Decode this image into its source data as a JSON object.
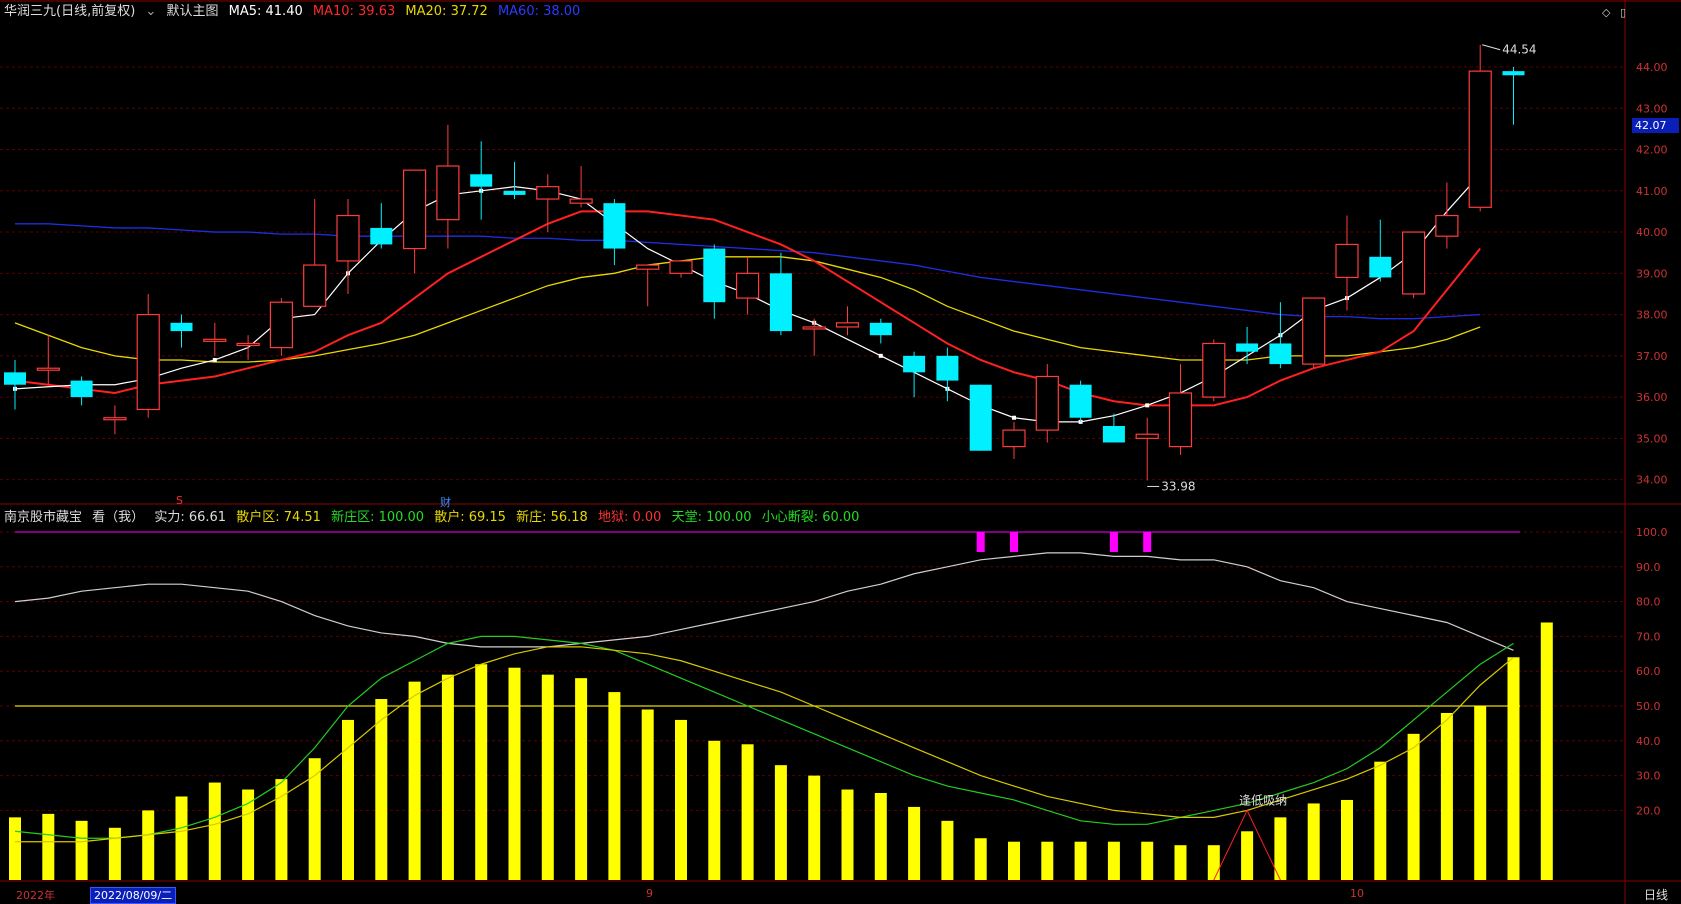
{
  "main_header": {
    "title": "华润三九(日线,前复权)",
    "dropdown_label": "默认主图",
    "ma5": "MA5: 41.40",
    "ma10": "MA10: 39.63",
    "ma20": "MA20: 37.72",
    "ma60": "MA60: 38.00"
  },
  "indicator_header": {
    "name": "南京股市藏宝",
    "view": "看（我）",
    "shili": "实力: 66.61",
    "sanhuqu": "散户区: 74.51",
    "xinzhuangqu": "新庄区: 100.00",
    "sanhu": "散户: 69.15",
    "xinzhuang": "新庄: 56.18",
    "diyu": "地狱: 0.00",
    "tiantang": "天堂: 100.00",
    "xiaoxin": "小心断裂: 60.00"
  },
  "colors": {
    "up": "#ff3c3c",
    "down": "#00f0ff",
    "ma5": "#ffffff",
    "ma10": "#ff2020",
    "ma20": "#e8d800",
    "ma60": "#1e2ee0",
    "bars": "#ffff00",
    "magenta": "#ff00ff"
  },
  "price_axis": [
    "44.00",
    "43.00",
    "42.00",
    "41.00",
    "40.00",
    "39.00",
    "38.00",
    "37.00",
    "36.00",
    "35.00",
    "34.00"
  ],
  "ind_axis": [
    "100.0",
    "90.0",
    "80.0",
    "70.0",
    "60.0",
    "50.0",
    "40.0",
    "30.0",
    "20.0"
  ],
  "current_price": "42.07",
  "high_label": "44.54",
  "low_label": "33.98",
  "event_markers": {
    "s_marker": "S",
    "cai_marker": "财"
  },
  "annotation_text": "逢低吸纳",
  "x_axis": {
    "year": "2022年",
    "date_box": "2022/08/09/二",
    "month9": "9",
    "month10": "10"
  },
  "period": "日线",
  "icons": [
    "diamond-icon",
    "settings-icon"
  ],
  "chart_data": {
    "type": "candlestick",
    "candles": [
      {
        "o": 36.6,
        "h": 36.9,
        "c": 36.3,
        "l": 35.7
      },
      {
        "o": 36.7,
        "h": 37.5,
        "c": 36.7,
        "l": 36.3
      },
      {
        "o": 36.4,
        "h": 36.5,
        "c": 36.0,
        "l": 35.8
      },
      {
        "o": 35.5,
        "h": 35.8,
        "c": 35.5,
        "l": 35.1
      },
      {
        "o": 35.7,
        "h": 38.5,
        "c": 38.0,
        "l": 35.5
      },
      {
        "o": 37.8,
        "h": 38.0,
        "c": 37.6,
        "l": 37.2
      },
      {
        "o": 37.4,
        "h": 37.8,
        "c": 37.4,
        "l": 37.0
      },
      {
        "o": 37.3,
        "h": 37.5,
        "c": 37.3,
        "l": 36.9
      },
      {
        "o": 37.2,
        "h": 38.4,
        "c": 38.3,
        "l": 37.0
      },
      {
        "o": 38.2,
        "h": 40.8,
        "c": 39.2,
        "l": 38.2
      },
      {
        "o": 39.3,
        "h": 40.8,
        "c": 40.4,
        "l": 38.5
      },
      {
        "o": 40.1,
        "h": 40.7,
        "c": 39.7,
        "l": 39.6
      },
      {
        "o": 39.6,
        "h": 41.5,
        "c": 41.5,
        "l": 39.0
      },
      {
        "o": 40.3,
        "h": 42.6,
        "c": 41.6,
        "l": 39.6
      },
      {
        "o": 41.4,
        "h": 42.2,
        "c": 41.1,
        "l": 40.3
      },
      {
        "o": 41.0,
        "h": 41.7,
        "c": 40.9,
        "l": 40.8
      },
      {
        "o": 40.8,
        "h": 41.4,
        "c": 41.1,
        "l": 40.0
      },
      {
        "o": 40.7,
        "h": 41.6,
        "c": 40.8,
        "l": 40.6
      },
      {
        "o": 40.7,
        "h": 40.8,
        "c": 39.6,
        "l": 39.2
      },
      {
        "o": 39.1,
        "h": 39.2,
        "c": 39.2,
        "l": 38.2
      },
      {
        "o": 39.0,
        "h": 39.3,
        "c": 39.3,
        "l": 38.9
      },
      {
        "o": 39.6,
        "h": 39.7,
        "c": 38.3,
        "l": 37.9
      },
      {
        "o": 38.4,
        "h": 39.4,
        "c": 39.0,
        "l": 38.0
      },
      {
        "o": 39.0,
        "h": 39.5,
        "c": 37.6,
        "l": 37.5
      },
      {
        "o": 37.7,
        "h": 37.9,
        "c": 37.7,
        "l": 37.0
      },
      {
        "o": 37.7,
        "h": 38.2,
        "c": 37.8,
        "l": 37.5
      },
      {
        "o": 37.8,
        "h": 37.9,
        "c": 37.5,
        "l": 37.3
      },
      {
        "o": 37.0,
        "h": 37.1,
        "c": 36.6,
        "l": 36.0
      },
      {
        "o": 37.0,
        "h": 37.2,
        "c": 36.4,
        "l": 35.9
      },
      {
        "o": 36.3,
        "h": 36.3,
        "c": 34.7,
        "l": 34.7
      },
      {
        "o": 34.8,
        "h": 35.4,
        "c": 35.2,
        "l": 34.5
      },
      {
        "o": 35.2,
        "h": 36.8,
        "c": 36.5,
        "l": 34.9
      },
      {
        "o": 36.3,
        "h": 36.4,
        "c": 35.5,
        "l": 35.4
      },
      {
        "o": 35.3,
        "h": 35.6,
        "c": 34.9,
        "l": 34.9
      },
      {
        "o": 35.0,
        "h": 35.5,
        "c": 35.1,
        "l": 33.98
      },
      {
        "o": 34.8,
        "h": 36.8,
        "c": 36.1,
        "l": 34.6
      },
      {
        "o": 36.0,
        "h": 37.4,
        "c": 37.3,
        "l": 35.9
      },
      {
        "o": 37.3,
        "h": 37.7,
        "c": 37.1,
        "l": 36.8
      },
      {
        "o": 37.3,
        "h": 38.3,
        "c": 36.8,
        "l": 36.7
      },
      {
        "o": 36.8,
        "h": 38.4,
        "c": 38.4,
        "l": 36.7
      },
      {
        "o": 38.9,
        "h": 40.4,
        "c": 39.7,
        "l": 38.1
      },
      {
        "o": 39.4,
        "h": 40.3,
        "c": 38.9,
        "l": 38.8
      },
      {
        "o": 38.5,
        "h": 40.0,
        "c": 40.0,
        "l": 38.4
      },
      {
        "o": 39.9,
        "h": 41.2,
        "c": 40.4,
        "l": 39.6
      },
      {
        "o": 40.6,
        "h": 44.54,
        "c": 43.9,
        "l": 40.5
      },
      {
        "o": 43.9,
        "h": 44.0,
        "c": 43.8,
        "l": 42.6
      }
    ],
    "ma5": [
      36.2,
      36.25,
      36.3,
      36.3,
      36.45,
      36.7,
      36.9,
      37.2,
      37.9,
      38.0,
      39.0,
      39.8,
      40.5,
      40.9,
      41.0,
      41.1,
      41.0,
      40.8,
      40.2,
      39.6,
      39.2,
      38.8,
      38.5,
      38.1,
      37.8,
      37.4,
      37.0,
      36.6,
      36.2,
      35.8,
      35.5,
      35.4,
      35.4,
      35.55,
      35.8,
      36.1,
      36.5,
      37.0,
      37.5,
      38.1,
      38.4,
      38.9,
      39.5,
      40.5,
      41.4
    ],
    "ma10": [
      36.4,
      36.3,
      36.2,
      36.1,
      36.3,
      36.4,
      36.5,
      36.7,
      36.9,
      37.1,
      37.5,
      37.8,
      38.4,
      39.0,
      39.4,
      39.8,
      40.2,
      40.5,
      40.5,
      40.5,
      40.4,
      40.3,
      40.0,
      39.7,
      39.3,
      38.8,
      38.3,
      37.8,
      37.3,
      36.9,
      36.6,
      36.4,
      36.1,
      35.9,
      35.8,
      35.8,
      35.8,
      36.0,
      36.4,
      36.7,
      36.9,
      37.1,
      37.6,
      38.6,
      39.6
    ],
    "ma20": [
      37.8,
      37.5,
      37.2,
      37.0,
      36.9,
      36.9,
      36.85,
      36.85,
      36.9,
      37.0,
      37.15,
      37.3,
      37.5,
      37.8,
      38.1,
      38.4,
      38.7,
      38.9,
      39.0,
      39.2,
      39.3,
      39.4,
      39.4,
      39.4,
      39.3,
      39.1,
      38.9,
      38.6,
      38.2,
      37.9,
      37.6,
      37.4,
      37.2,
      37.1,
      37.0,
      36.9,
      36.9,
      36.9,
      37.0,
      37.0,
      37.0,
      37.1,
      37.2,
      37.4,
      37.7
    ],
    "ma60": [
      40.2,
      40.2,
      40.15,
      40.1,
      40.1,
      40.05,
      40.0,
      40.0,
      39.95,
      39.95,
      39.9,
      39.9,
      39.9,
      39.9,
      39.9,
      39.85,
      39.85,
      39.8,
      39.8,
      39.75,
      39.7,
      39.65,
      39.6,
      39.55,
      39.5,
      39.4,
      39.3,
      39.2,
      39.05,
      38.9,
      38.8,
      38.7,
      38.6,
      38.5,
      38.4,
      38.3,
      38.2,
      38.1,
      38.0,
      37.95,
      37.95,
      37.9,
      37.9,
      37.95,
      38.0
    ],
    "ind_bars": [
      18,
      19,
      17,
      15,
      20,
      24,
      28,
      26,
      29,
      35,
      46,
      52,
      57,
      59,
      62,
      61,
      59,
      58,
      54,
      49,
      46,
      40,
      39,
      33,
      30,
      26,
      25,
      21,
      17,
      12,
      11,
      11,
      11,
      11,
      11,
      10,
      10,
      14,
      18,
      22,
      23,
      34,
      42,
      48,
      50,
      64,
      74
    ],
    "ind_white": [
      80,
      81,
      83,
      84,
      85,
      85,
      84,
      83,
      80,
      76,
      73,
      71,
      70,
      68,
      67,
      67,
      67,
      68,
      69,
      70,
      72,
      74,
      76,
      78,
      80,
      83,
      85,
      88,
      90,
      92,
      93,
      94,
      94,
      93,
      93,
      92,
      92,
      90,
      86,
      84,
      80,
      78,
      76,
      74,
      70,
      66
    ],
    "ind_green": [
      14,
      13,
      12,
      12,
      13,
      15,
      18,
      22,
      28,
      38,
      50,
      58,
      63,
      68,
      70,
      70,
      69,
      68,
      66,
      62,
      58,
      54,
      50,
      46,
      42,
      38,
      34,
      30,
      27,
      25,
      23,
      20,
      17,
      16,
      16,
      18,
      20,
      22,
      25,
      28,
      32,
      38,
      46,
      54,
      62,
      68
    ],
    "ind_yellow": [
      11,
      11,
      11,
      12,
      13,
      14,
      16,
      19,
      24,
      30,
      38,
      46,
      53,
      58,
      62,
      65,
      67,
      67,
      66,
      65,
      63,
      60,
      57,
      54,
      50,
      46,
      42,
      38,
      34,
      30,
      27,
      24,
      22,
      20,
      19,
      18,
      18,
      20,
      23,
      26,
      29,
      33,
      38,
      46,
      56,
      64
    ]
  }
}
